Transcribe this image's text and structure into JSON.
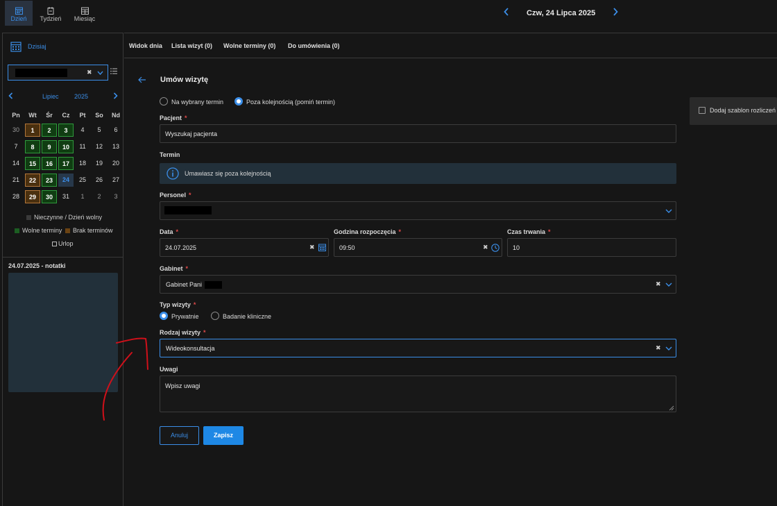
{
  "topbar": {
    "views": [
      {
        "label": "Dzień",
        "icon": "calendar-day-icon",
        "active": true
      },
      {
        "label": "Tydzień",
        "icon": "calendar-week-icon",
        "active": false
      },
      {
        "label": "Miesiąc",
        "icon": "calendar-month-icon",
        "active": false
      }
    ],
    "date_title": "Czw, 24 Lipca 2025"
  },
  "sidebar": {
    "today_label": "Dzisiaj",
    "calendar": {
      "month": "Lipiec",
      "year": "2025",
      "weekdays": [
        "Pn",
        "Wt",
        "Śr",
        "Cz",
        "Pt",
        "So",
        "Nd"
      ],
      "weeks": [
        [
          {
            "d": "30",
            "s": "muted"
          },
          {
            "d": "1",
            "s": "none"
          },
          {
            "d": "2",
            "s": "free"
          },
          {
            "d": "3",
            "s": "free"
          },
          {
            "d": "4",
            "s": ""
          },
          {
            "d": "5",
            "s": ""
          },
          {
            "d": "6",
            "s": ""
          }
        ],
        [
          {
            "d": "7",
            "s": ""
          },
          {
            "d": "8",
            "s": "free"
          },
          {
            "d": "9",
            "s": "free"
          },
          {
            "d": "10",
            "s": "free"
          },
          {
            "d": "11",
            "s": ""
          },
          {
            "d": "12",
            "s": ""
          },
          {
            "d": "13",
            "s": ""
          }
        ],
        [
          {
            "d": "14",
            "s": ""
          },
          {
            "d": "15",
            "s": "free"
          },
          {
            "d": "16",
            "s": "free"
          },
          {
            "d": "17",
            "s": "free"
          },
          {
            "d": "18",
            "s": ""
          },
          {
            "d": "19",
            "s": ""
          },
          {
            "d": "20",
            "s": ""
          }
        ],
        [
          {
            "d": "21",
            "s": ""
          },
          {
            "d": "22",
            "s": "none"
          },
          {
            "d": "23",
            "s": "free"
          },
          {
            "d": "24",
            "s": "today"
          },
          {
            "d": "25",
            "s": ""
          },
          {
            "d": "26",
            "s": ""
          },
          {
            "d": "27",
            "s": ""
          }
        ],
        [
          {
            "d": "28",
            "s": ""
          },
          {
            "d": "29",
            "s": "none"
          },
          {
            "d": "30",
            "s": "free"
          },
          {
            "d": "31",
            "s": ""
          },
          {
            "d": "1",
            "s": "muted"
          },
          {
            "d": "2",
            "s": "muted"
          },
          {
            "d": "3",
            "s": "muted"
          }
        ]
      ]
    },
    "legend": {
      "inactive": "Nieczynne / Dzień wolny",
      "free": "Wolne terminy",
      "no_slots": "Brak terminów",
      "leave": "Urlop"
    },
    "notes_title": "24.07.2025 - notatki"
  },
  "tabs": [
    "Widok dnia",
    "Lista wizyt (0)",
    "Wolne terminy (0)",
    "Do umówienia (0)"
  ],
  "form": {
    "title": "Umów wizytę",
    "mode_options": [
      "Na wybrany termin",
      "Poza kolejnością (pomiń termin)"
    ],
    "patient_label": "Pacjent",
    "patient_placeholder": "Wyszukaj pacjenta",
    "termin_label": "Termin",
    "termin_info": "Umawiasz się poza kolejnością",
    "staff_label": "Personel",
    "date_label": "Data",
    "date_value": "24.07.2025",
    "start_label": "Godzina rozpoczęcia",
    "start_value": "09:50",
    "duration_label": "Czas trwania",
    "duration_value": "10",
    "room_label": "Gabinet",
    "room_value": "Gabinet Pani",
    "visit_type_label": "Typ wizyty",
    "visit_type_options": [
      "Prywatnie",
      "Badanie kliniczne"
    ],
    "visit_kind_label": "Rodzaj wizyty",
    "visit_kind_value": "Wideokonsultacja",
    "notes_label": "Uwagi",
    "notes_placeholder": "Wpisz uwagi",
    "cancel_label": "Anuluj",
    "save_label": "Zapisz"
  },
  "template_checkbox_label": "Dodaj szablon rozliczeń",
  "colors": {
    "accent": "#3b8ee8",
    "free": "#2f9a3c",
    "no_slots": "#b3773a",
    "required": "#e04a4a",
    "annotation": "#d0101a"
  }
}
